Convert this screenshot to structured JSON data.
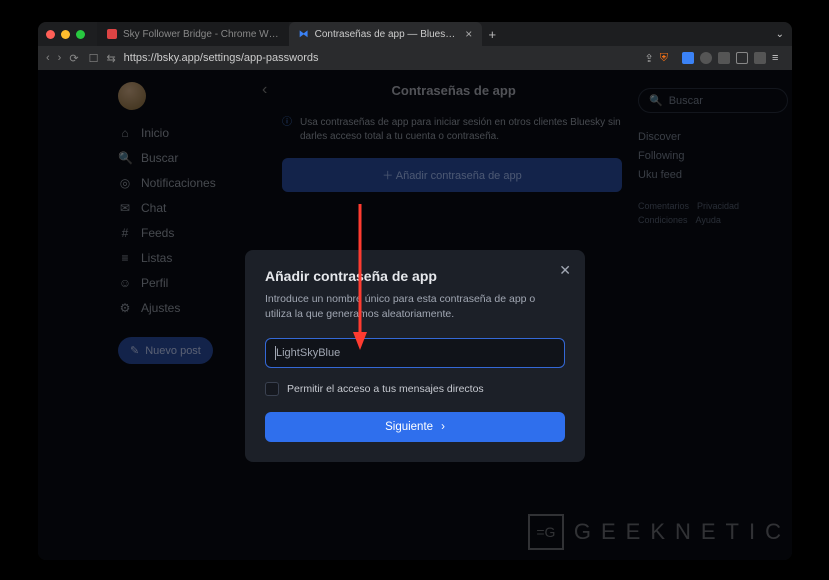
{
  "browser": {
    "tabs": [
      {
        "label": "Sky Follower Bridge - Chrome W…"
      },
      {
        "label": "Contraseñas de app — Blues…"
      }
    ],
    "url": "https://bsky.app/settings/app-passwords"
  },
  "sidebar": {
    "items": [
      {
        "icon": "home-icon",
        "glyph": "⌂",
        "label": "Inicio"
      },
      {
        "icon": "search-icon",
        "glyph": "🔍",
        "label": "Buscar"
      },
      {
        "icon": "bell-icon",
        "glyph": "◎",
        "label": "Notificaciones"
      },
      {
        "icon": "chat-icon",
        "glyph": "✉",
        "label": "Chat"
      },
      {
        "icon": "hash-icon",
        "glyph": "#",
        "label": "Feeds"
      },
      {
        "icon": "list-icon",
        "glyph": "≡",
        "label": "Listas"
      },
      {
        "icon": "profile-icon",
        "glyph": "☺",
        "label": "Perfil"
      },
      {
        "icon": "gear-icon",
        "glyph": "⚙",
        "label": "Ajustes"
      }
    ],
    "new_post": "Nuevo post"
  },
  "main": {
    "title": "Contraseñas de app",
    "info_text": "Usa contraseñas de app para iniciar sesión en otros clientes Bluesky sin darles acceso total a tu cuenta o contraseña.",
    "add_button": "Añadir contraseña de app"
  },
  "right": {
    "search_placeholder": "Buscar",
    "feeds": [
      "Discover",
      "Following",
      "Uku feed"
    ],
    "links": [
      "Comentarios",
      "Privacidad",
      "Condiciones",
      "Ayuda"
    ]
  },
  "modal": {
    "title": "Añadir contraseña de app",
    "description": "Introduce un nombre único para esta contraseña de app o utiliza la que generamos aleatoriamente.",
    "input_value": "LightSkyBlue",
    "checkbox_label": "Permitir el acceso a tus mensajes directos",
    "next_label": "Siguiente"
  },
  "watermark": "GEEKNETIC"
}
